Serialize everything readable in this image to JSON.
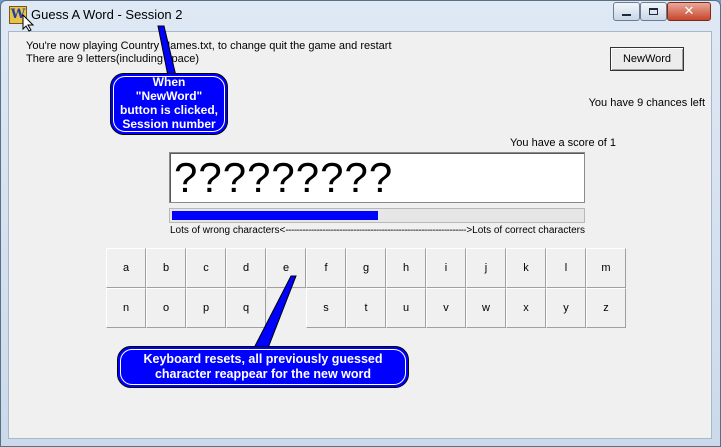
{
  "window": {
    "title": "Guess A Word - Session 2",
    "app_icon_glyph": "W",
    "controls": {
      "minimize": "minimize-icon",
      "maximize": "maximize-icon",
      "close": "close-icon"
    }
  },
  "info": {
    "line1": "You're now playing Country Names.txt, to change quit the game and restart",
    "line2": "There are 9 letters(including space)"
  },
  "buttons": {
    "new_word": "NewWord"
  },
  "status": {
    "chances": "You have 9 chances left",
    "score": "You have a score of 1"
  },
  "word_display": "?????????",
  "progress": {
    "fraction": 0.5,
    "left_caption": "Lots of wrong characters<",
    "right_caption": ">Lots of correct characters",
    "fill_color": "#0000ff"
  },
  "keyboard": {
    "row1": [
      "a",
      "b",
      "c",
      "d",
      "e",
      "f",
      "g",
      "h",
      "i",
      "j",
      "k",
      "l",
      "m"
    ],
    "row2": [
      "n",
      "o",
      "p",
      "q",
      "",
      "s",
      "t",
      "u",
      "v",
      "w",
      "x",
      "y",
      "z"
    ]
  },
  "callouts": {
    "top": [
      "When",
      "\"NewWord\"",
      "button is clicked,",
      "Session number"
    ],
    "bottom": [
      "Keyboard resets, all previously guessed",
      "character reappear for the new word"
    ],
    "fill_color": "#0000ff"
  }
}
